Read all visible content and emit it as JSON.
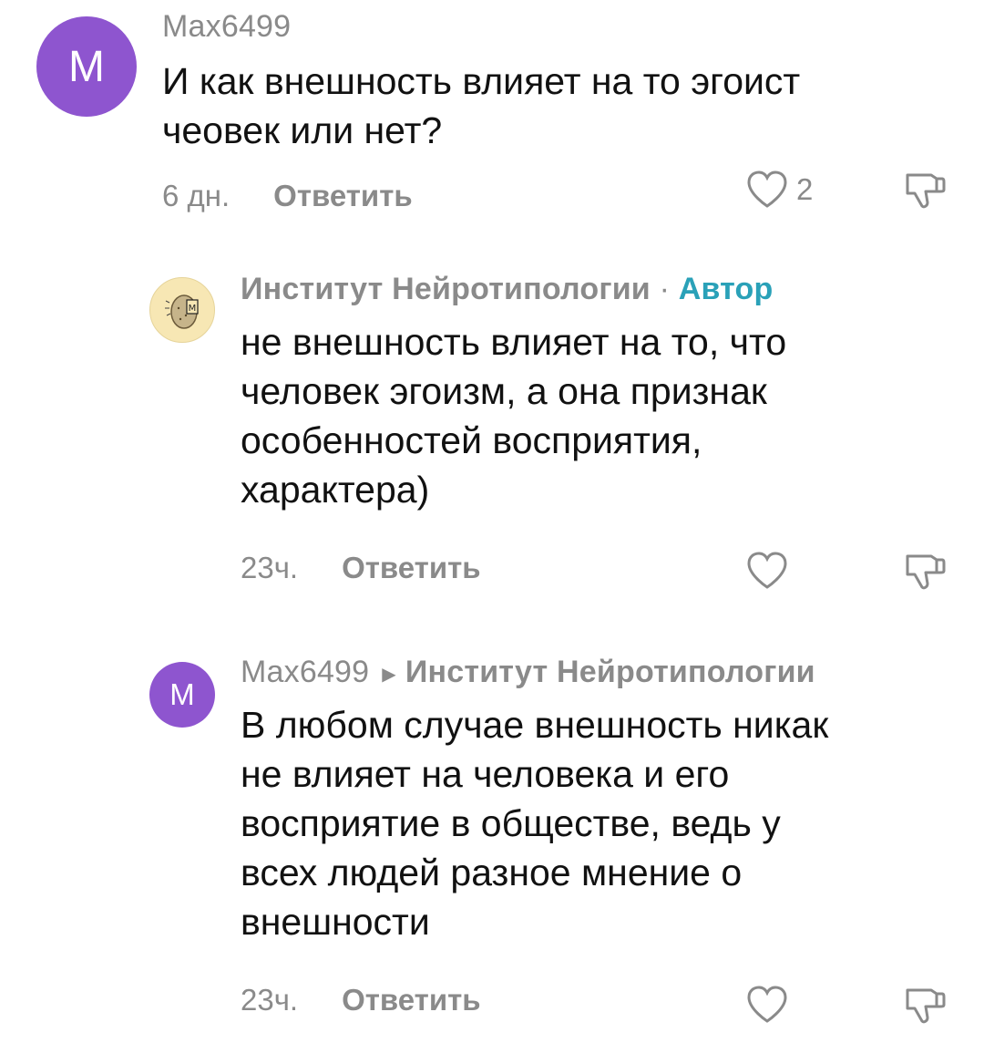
{
  "comments": [
    {
      "avatar_letter": "M",
      "author": "Max6499",
      "text": "И как внешность влияет на то эгоист\nчеовек или нет?",
      "time": "6 дн.",
      "reply_label": "Ответить",
      "like_count": "2",
      "avatar_color": "#8e55cf"
    },
    {
      "author": "Институт Нейротипологии",
      "separator": "·",
      "badge": "Автор",
      "text": "не внешность влияет на то, что\nчеловек эгоизм, а она признак\nособенностей восприятия,\nхарактера)",
      "time": "23ч.",
      "reply_label": "Ответить",
      "badge_color": "#2aa1b8"
    },
    {
      "avatar_letter": "M",
      "author": "Max6499",
      "reply_to": "Институт Нейротипологии",
      "text": "В любом случае внешность никак\nне влияет на человека и его\nвосприятие в обществе, ведь у\nвсех людей разное мнение о\nвнешности",
      "time": "23ч.",
      "reply_label": "Ответить",
      "avatar_color": "#8e55cf"
    }
  ]
}
